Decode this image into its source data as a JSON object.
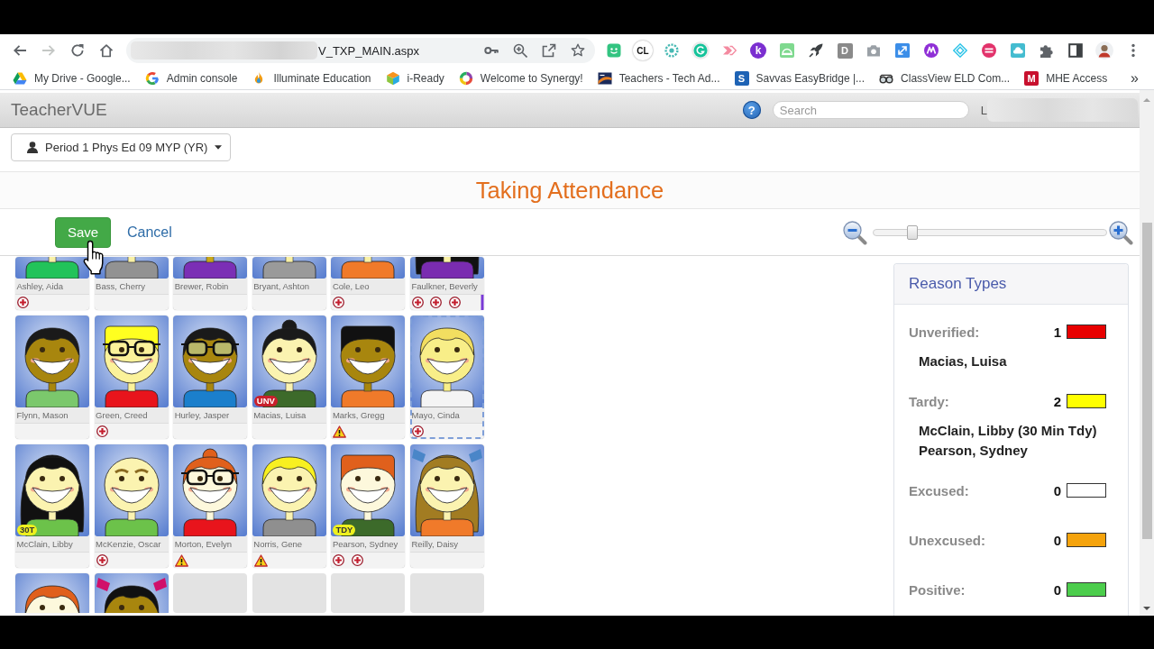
{
  "browser": {
    "nav": [
      {
        "kind": "back",
        "disabled": false
      },
      {
        "kind": "forward",
        "disabled": true
      },
      {
        "kind": "reload",
        "disabled": false
      },
      {
        "kind": "home",
        "disabled": false
      }
    ],
    "address_bar": {
      "url": "V_TXP_MAIN.aspx"
    },
    "extensions": [
      {
        "kind": "smiley"
      },
      {
        "kind": "coin",
        "label": "CL"
      },
      {
        "kind": "gear"
      },
      {
        "kind": "circle"
      },
      {
        "kind": "arrow"
      },
      {
        "kind": "disc",
        "label": "k"
      },
      {
        "kind": "dome"
      },
      {
        "kind": "rocket"
      },
      {
        "kind": "tile",
        "label": "D"
      },
      {
        "kind": "camera"
      },
      {
        "kind": "expand"
      },
      {
        "kind": "zigzag"
      },
      {
        "kind": "diamond"
      },
      {
        "kind": "stripes"
      },
      {
        "kind": "cloud"
      },
      {
        "kind": "puzzle"
      },
      {
        "kind": "panel"
      },
      {
        "kind": "profile"
      },
      {
        "kind": "more"
      }
    ],
    "bookmarks": [
      {
        "kind": "triangle",
        "label": "My Drive - Google..."
      },
      {
        "kind": "arcs",
        "label": "Admin console"
      },
      {
        "kind": "flame",
        "label": "Illuminate Education"
      },
      {
        "kind": "cube",
        "label": "i-Ready"
      },
      {
        "kind": "ring",
        "label": "Welcome to Synergy!"
      },
      {
        "kind": "emblem",
        "label": "Teachers - Tech Ad..."
      },
      {
        "kind": "letter",
        "icon_label": "S",
        "color": "#1e63b5",
        "label": "Savvas EasyBridge |..."
      },
      {
        "kind": "goggles",
        "label": "ClassView ELD Com..."
      },
      {
        "kind": "letter",
        "icon_label": "M",
        "color": "#c8102e",
        "label": "MHE Access"
      }
    ],
    "bookmarks_overflow": "»"
  },
  "teachervue": {
    "app_title": "TeacherVUE",
    "help_button": {
      "label": "?"
    },
    "search": {
      "placeholder": "Search"
    },
    "user_label": "L",
    "class_selector": {
      "value": "Period 1 Phys Ed 09 MYP (YR)"
    },
    "heading": "Taking Attendance",
    "actions": [
      {
        "kind": "primary",
        "label": "Save"
      },
      {
        "kind": "link",
        "label": "Cancel"
      }
    ],
    "zoom_slider": {
      "level": 0.17
    },
    "students": [
      {
        "kind": "avatar",
        "name": "Ashley, Aida",
        "selected": false,
        "flags": [
          {
            "kind": "health"
          }
        ]
      },
      {
        "kind": "avatar",
        "name": "Bass, Cherry",
        "selected": false
      },
      {
        "kind": "avatar",
        "name": "Brewer, Robin",
        "selected": false
      },
      {
        "kind": "avatar",
        "name": "Bryant, Ashton",
        "selected": false
      },
      {
        "kind": "avatar",
        "name": "Cole, Leo",
        "selected": false,
        "flags": [
          {
            "kind": "health"
          }
        ]
      },
      {
        "kind": "avatar",
        "name": "Faulkner, Beverly",
        "selected": false,
        "flags": [
          {
            "kind": "health"
          },
          {
            "kind": "health"
          },
          {
            "kind": "health"
          },
          {
            "kind": "bar"
          }
        ]
      },
      {
        "kind": "avatar",
        "name": "Flynn, Mason",
        "selected": false
      },
      {
        "kind": "avatar",
        "name": "Green, Creed",
        "selected": false,
        "flags": [
          {
            "kind": "health"
          }
        ]
      },
      {
        "kind": "avatar",
        "name": "Hurley, Jasper",
        "selected": false
      },
      {
        "kind": "avatar",
        "name": "Macias, Luisa",
        "selected": false,
        "badge": {
          "label": "UNV",
          "color": "#c8202c"
        }
      },
      {
        "kind": "avatar",
        "name": "Marks, Gregg",
        "selected": false,
        "flags": [
          {
            "kind": "warning"
          }
        ]
      },
      {
        "kind": "avatar",
        "name": "Mayo, Cinda",
        "selected": true,
        "flags": [
          {
            "kind": "health"
          }
        ]
      },
      {
        "kind": "avatar",
        "name": "McClain, Libby",
        "selected": false,
        "badge": {
          "label": "30T",
          "color": "#eef01e"
        }
      },
      {
        "kind": "avatar",
        "name": "McKenzie, Oscar",
        "selected": false,
        "flags": [
          {
            "kind": "health"
          }
        ]
      },
      {
        "kind": "avatar",
        "name": "Morton, Evelyn",
        "selected": false,
        "flags": [
          {
            "kind": "warning"
          }
        ]
      },
      {
        "kind": "avatar",
        "name": "Norris, Gene",
        "selected": false,
        "flags": [
          {
            "kind": "warning"
          }
        ]
      },
      {
        "kind": "avatar",
        "name": "Pearson, Sydney",
        "selected": false,
        "badge": {
          "label": "TDY",
          "color": "#eef01e"
        },
        "flags": [
          {
            "kind": "health"
          },
          {
            "kind": "health"
          }
        ]
      },
      {
        "kind": "avatar",
        "name": "Reilly, Daisy",
        "selected": false
      },
      {
        "kind": "avatar",
        "selected": false
      },
      {
        "kind": "avatar",
        "selected": false
      },
      {
        "kind": "empty",
        "selected": false
      },
      {
        "kind": "empty",
        "selected": false
      },
      {
        "kind": "empty",
        "selected": false
      },
      {
        "kind": "empty",
        "selected": false
      }
    ],
    "reason_types": {
      "title": "Reason Types",
      "items": [
        {
          "label": "Unverified:",
          "count": "1",
          "color": "#e80000",
          "students": [
            "Macias, Luisa"
          ]
        },
        {
          "label": "Tardy:",
          "count": "2",
          "color": "#ffff00",
          "students": [
            "McClain, Libby (30 Min Tdy)",
            "Pearson, Sydney"
          ]
        },
        {
          "label": "Excused:",
          "count": "0",
          "color": "#ffffff"
        },
        {
          "label": "Unexcused:",
          "count": "0",
          "color": "#f5a30c"
        },
        {
          "label": "Positive:",
          "count": "0",
          "color": "#4ccd4c"
        }
      ]
    }
  }
}
